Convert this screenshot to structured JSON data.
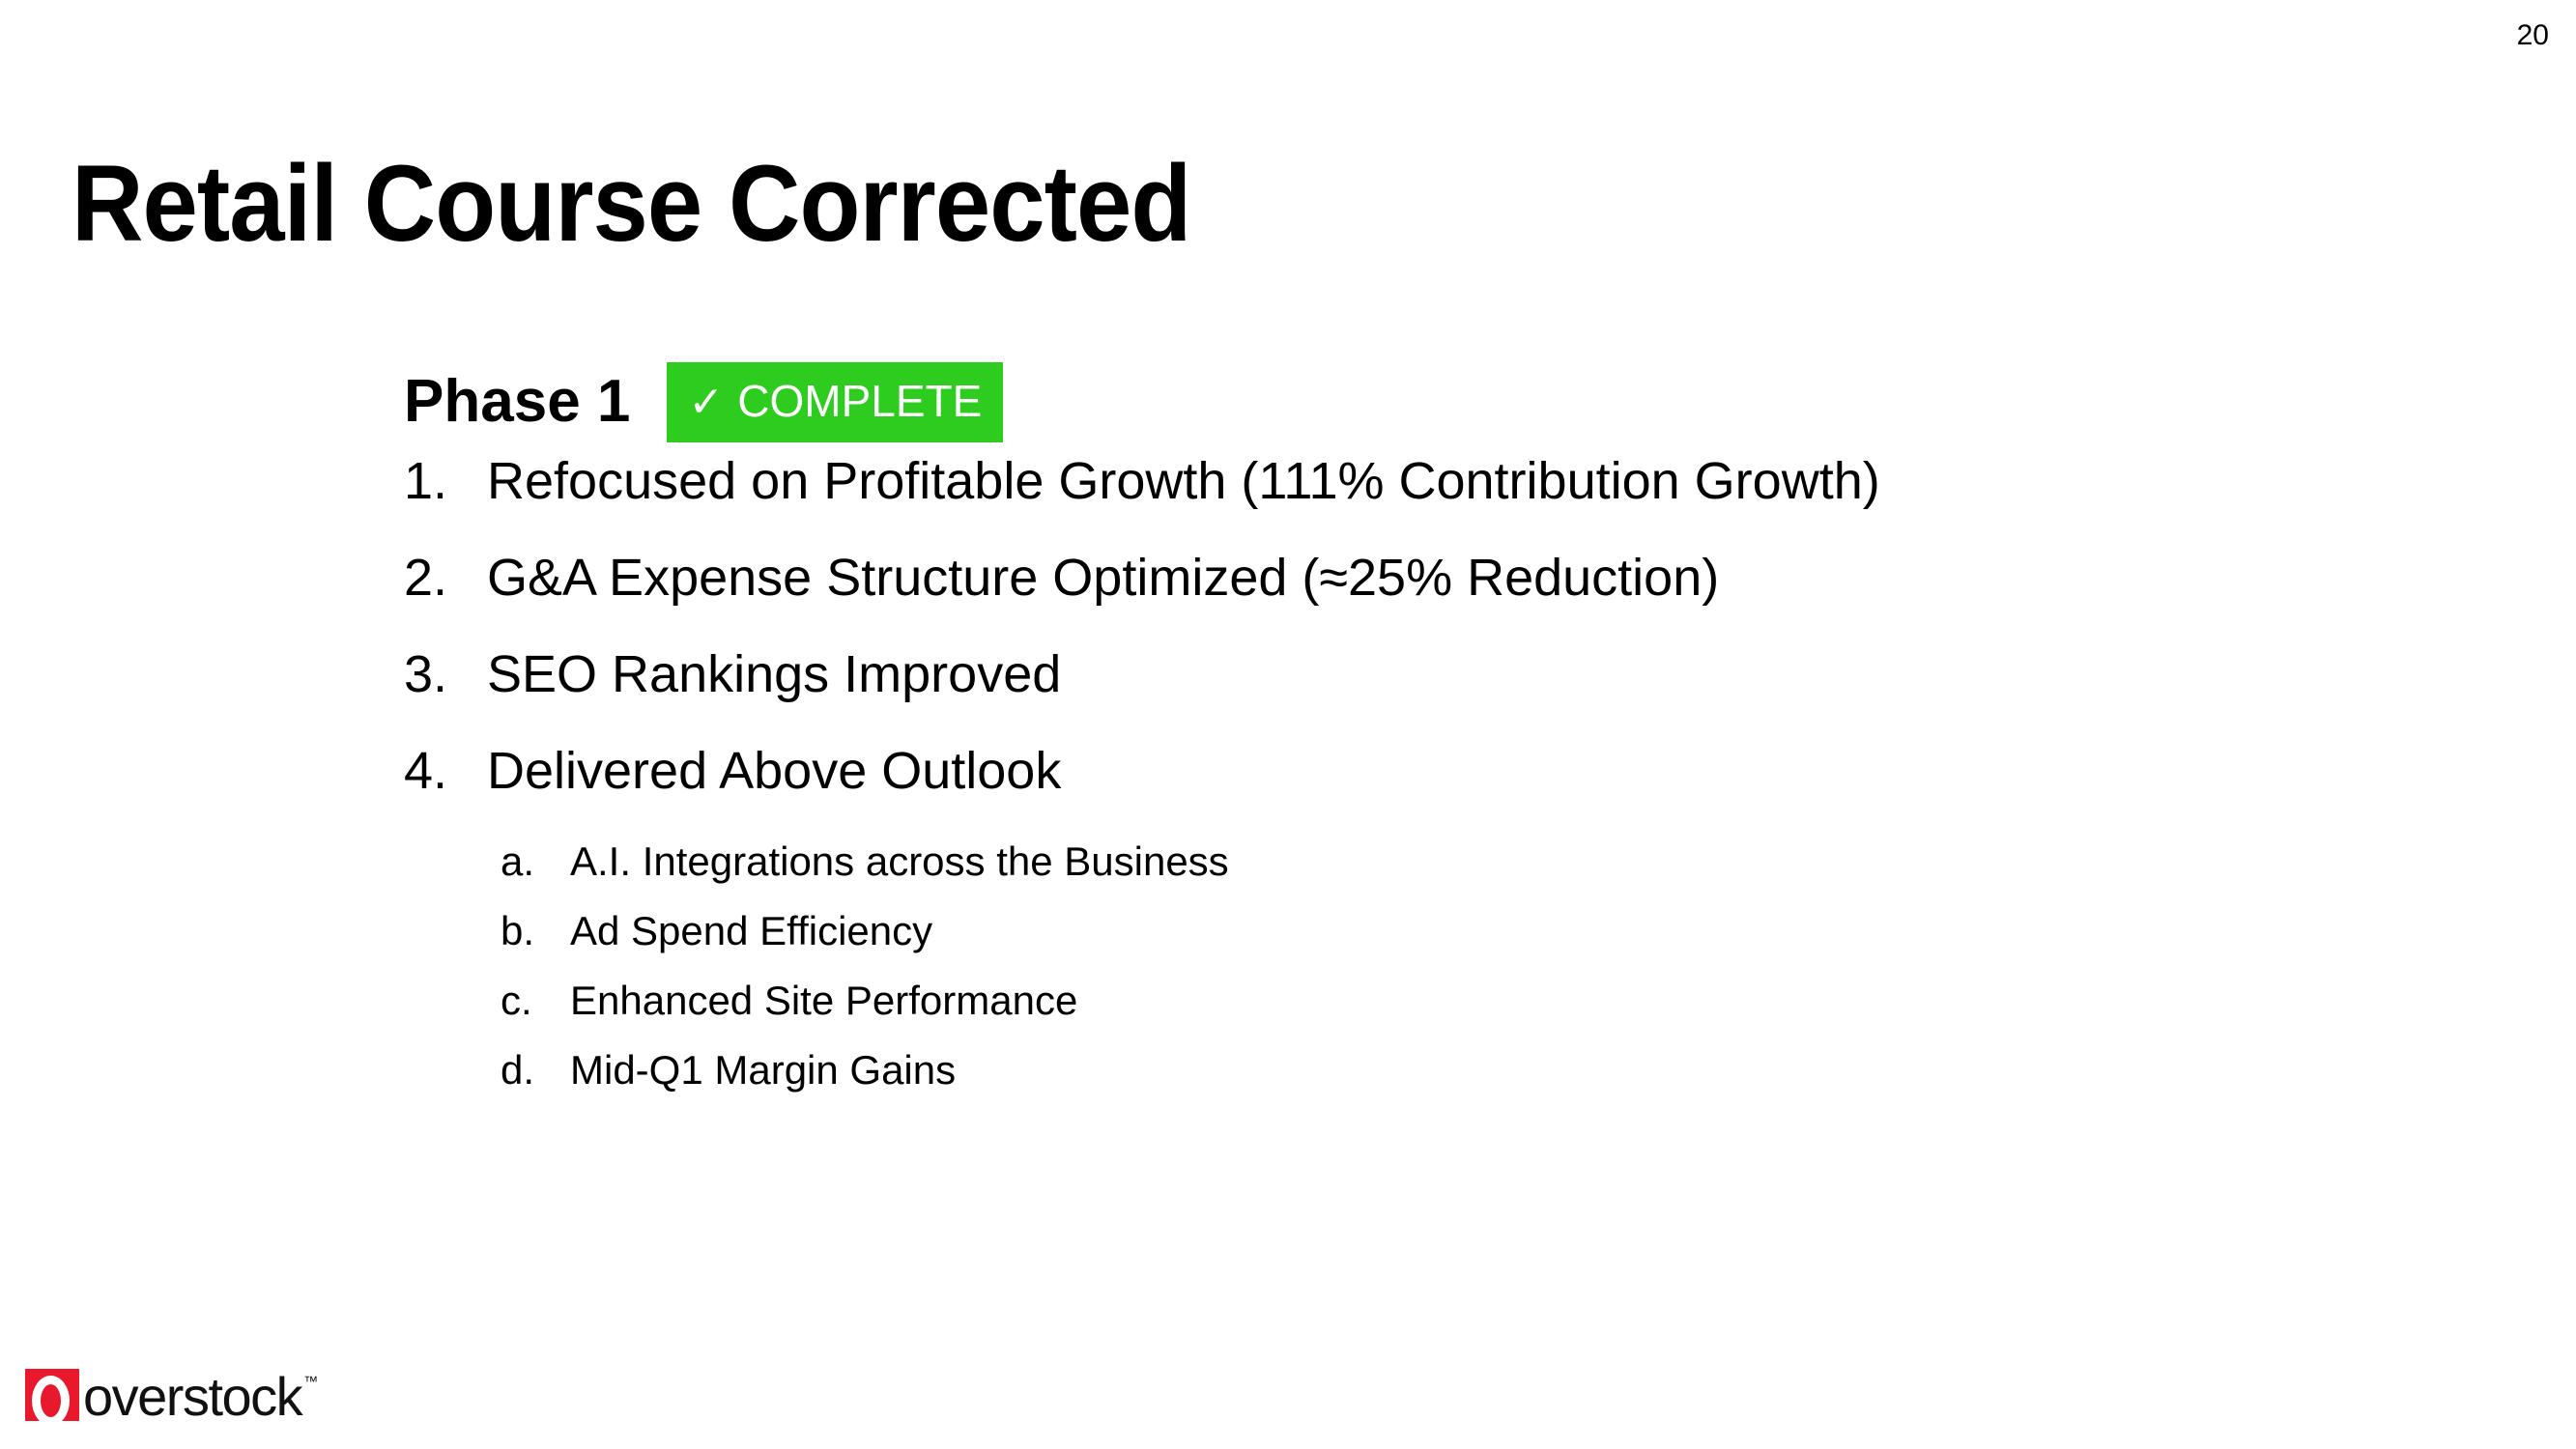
{
  "slide": {
    "page_number": "20",
    "title": "Retail Course Corrected",
    "background_color": "#FFFFFF"
  },
  "phase": {
    "label": "Phase 1",
    "badge": {
      "check_icon": "✓",
      "text": "COMPLETE",
      "background_color": "#2ECC1E",
      "text_color": "#FFFFFF"
    }
  },
  "numbered_list": [
    {
      "marker": "1.",
      "text": "Refocused on Profitable Growth (111% Contribution Growth)"
    },
    {
      "marker": "2.",
      "text": "G&A Expense Structure Optimized (≈25% Reduction)"
    },
    {
      "marker": "3.",
      "text": "SEO Rankings Improved"
    },
    {
      "marker": "4.",
      "text": "Delivered Above Outlook"
    }
  ],
  "sub_list": [
    {
      "marker": "a.",
      "text": "A.I. Integrations across the Business"
    },
    {
      "marker": "b.",
      "text": "Ad Spend Efficiency"
    },
    {
      "marker": "c.",
      "text": "Enhanced Site Performance"
    },
    {
      "marker": "d.",
      "text": "Mid-Q1 Margin Gains"
    }
  ],
  "logo": {
    "wordmark": "overstock",
    "trademark": "™",
    "mark_color": "#E8192C",
    "text_color": "#111111"
  }
}
